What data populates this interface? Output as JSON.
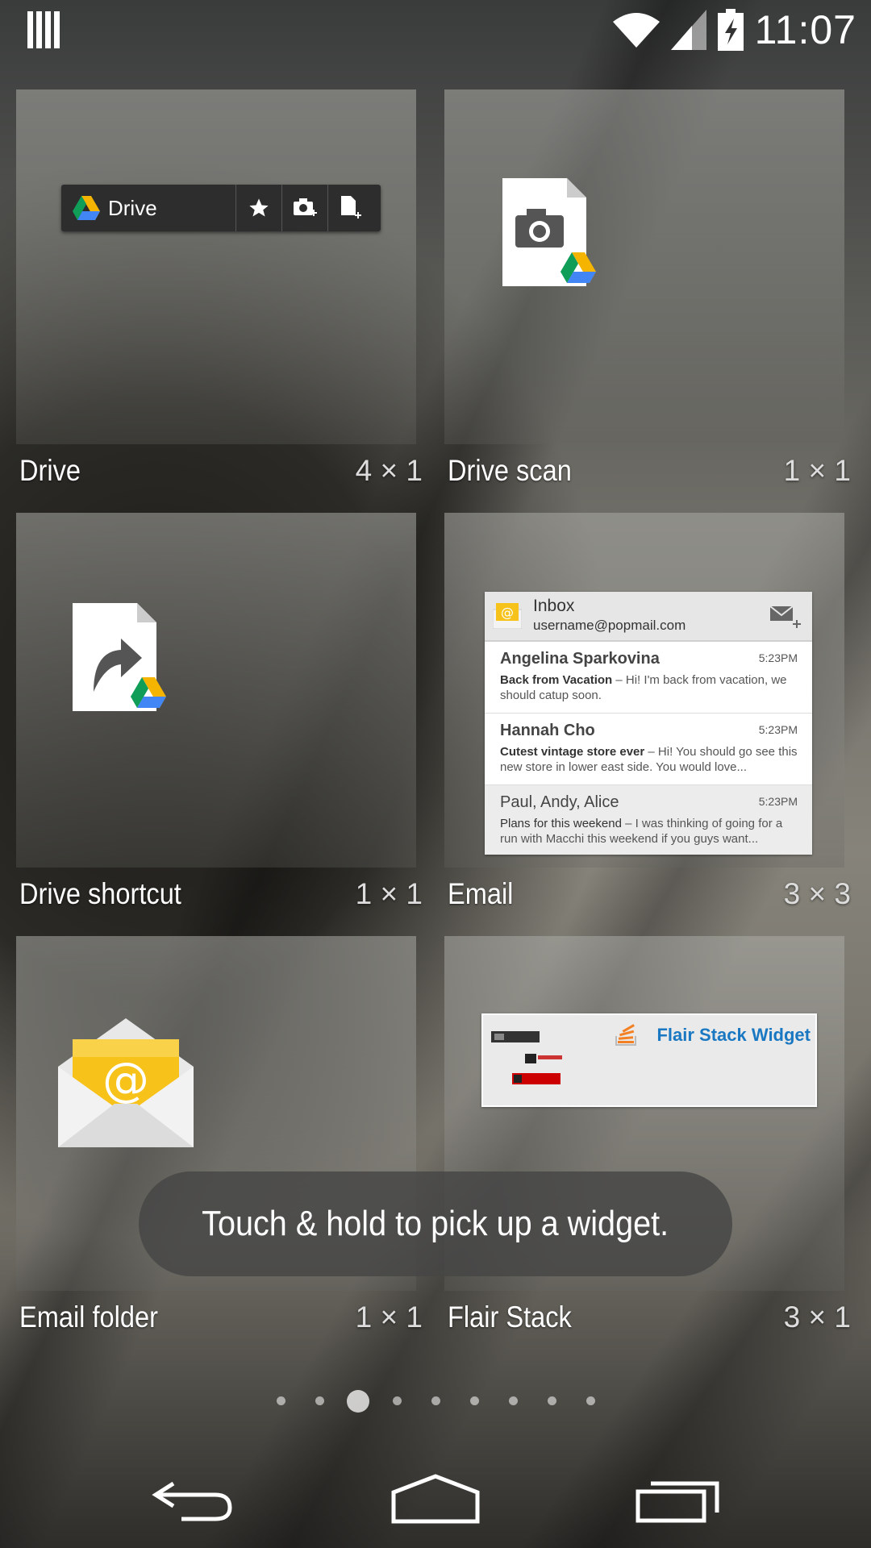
{
  "status_bar": {
    "time": "11:07",
    "icons": [
      "notification-bars-icon",
      "wifi-icon",
      "signal-icon",
      "battery-charging-icon"
    ]
  },
  "widgets": [
    {
      "name": "Drive",
      "size": "4 × 1",
      "preview_label": "Drive"
    },
    {
      "name": "Drive scan",
      "size": "1 × 1"
    },
    {
      "name": "Drive shortcut",
      "size": "1 × 1"
    },
    {
      "name": "Email",
      "size": "3 × 3"
    },
    {
      "name": "Email folder",
      "size": "1 × 1"
    },
    {
      "name": "Flair Stack",
      "size": "3 × 1",
      "preview_label": "Flair Stack Widget"
    }
  ],
  "email_preview": {
    "title": "Inbox",
    "account": "username@popmail.com",
    "messages": [
      {
        "from": "Angelina Sparkovina",
        "time": "5:23PM",
        "subject": "Back from Vacation",
        "snippet": " – Hi! I'm back from vacation, we should catup soon."
      },
      {
        "from": "Hannah Cho",
        "time": "5:23PM",
        "subject": "Cutest vintage store ever",
        "snippet": " – Hi! You should go see this new store in lower east side. You would love..."
      },
      {
        "from": "Paul, Andy, Alice",
        "time": "5:23PM",
        "subject": "Plans for this weekend",
        "snippet": " – I was thinking of going for a run with Macchi this weekend if you guys want..."
      }
    ]
  },
  "toast": "Touch & hold to pick up a widget.",
  "pager": {
    "count": 9,
    "active_index": 2
  }
}
